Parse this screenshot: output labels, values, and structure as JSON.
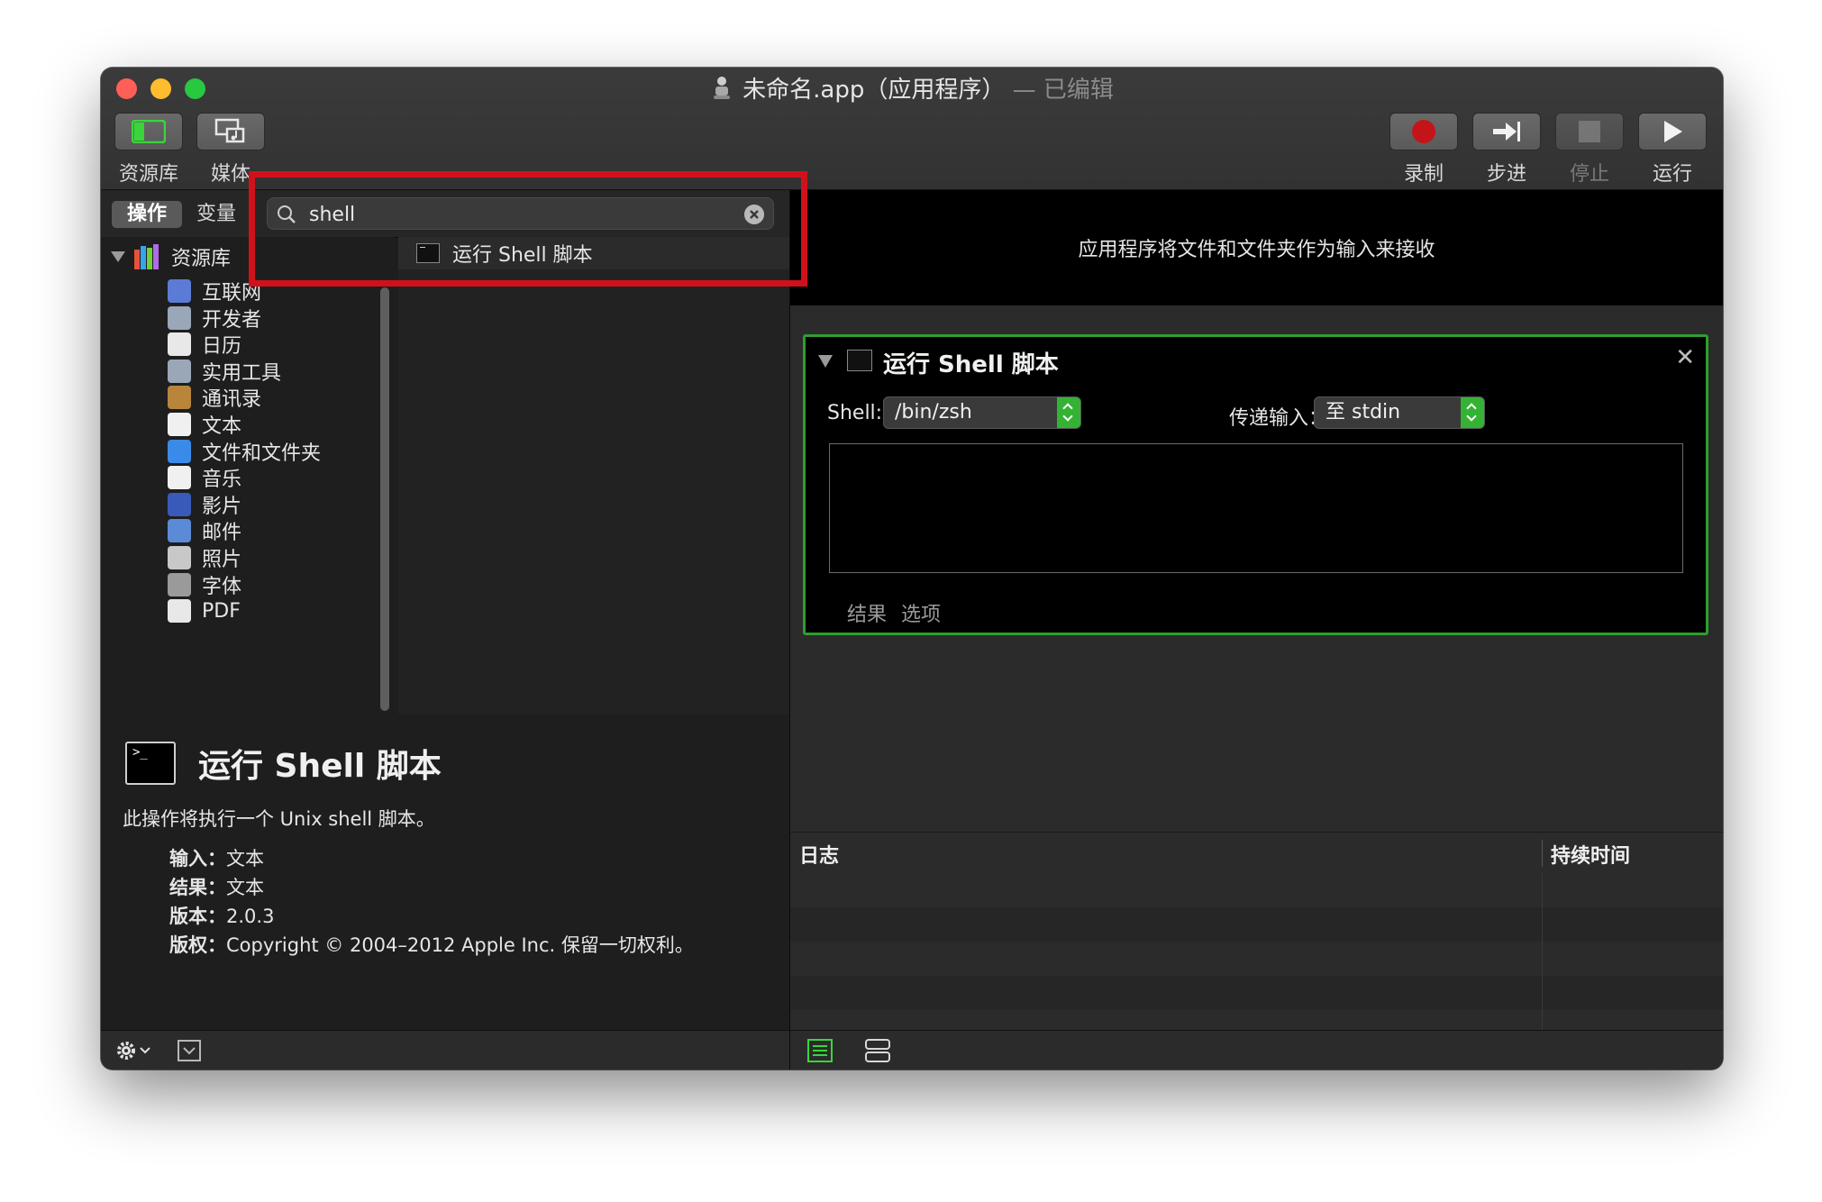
{
  "window": {
    "title": "未命名.app（应用程序）",
    "title_status": "— 已编辑"
  },
  "toolbar": {
    "library_label": "资源库",
    "media_label": "媒体",
    "record_label": "录制",
    "step_label": "步进",
    "stop_label": "停止",
    "run_label": "运行"
  },
  "left_tabs": {
    "actions": "操作",
    "variables": "变量"
  },
  "search": {
    "value": "shell"
  },
  "library": {
    "root": "资源库",
    "items": [
      {
        "label": "互联网",
        "icon": "globe-icon"
      },
      {
        "label": "开发者",
        "icon": "tools-icon"
      },
      {
        "label": "日历",
        "icon": "calendar-icon"
      },
      {
        "label": "实用工具",
        "icon": "tools-icon"
      },
      {
        "label": "通讯录",
        "icon": "contacts-icon"
      },
      {
        "label": "文本",
        "icon": "text-icon"
      },
      {
        "label": "文件和文件夹",
        "icon": "finder-icon"
      },
      {
        "label": "音乐",
        "icon": "music-icon"
      },
      {
        "label": "影片",
        "icon": "movie-icon"
      },
      {
        "label": "邮件",
        "icon": "mail-icon"
      },
      {
        "label": "照片",
        "icon": "photos-icon"
      },
      {
        "label": "字体",
        "icon": "font-icon"
      },
      {
        "label": "PDF",
        "icon": "pdf-icon"
      }
    ]
  },
  "results": [
    {
      "label": "运行 Shell 脚本"
    }
  ],
  "detail": {
    "icon_text": ">_",
    "title": "运行 Shell 脚本",
    "description": "此操作将执行一个 Unix shell 脚本。",
    "input_key": "输入：",
    "input_value": "文本",
    "result_key": "结果：",
    "result_value": "文本",
    "version_key": "版本：",
    "version_value": "2.0.3",
    "copyright_key": "版权：",
    "copyright_value": "Copyright © 2004–2012 Apple Inc. 保留一切权利。"
  },
  "workflow": {
    "banner": "应用程序将文件和文件夹作为输入来接收",
    "action": {
      "title": "运行 Shell 脚本",
      "shell_label": "Shell:",
      "shell_value": "/bin/zsh",
      "pass_label": "传递输入：",
      "pass_value": "至 stdin",
      "script": "",
      "tab_results": "结果",
      "tab_options": "选项"
    }
  },
  "log": {
    "col_log": "日志",
    "col_duration": "持续时间"
  },
  "colors": {
    "highlight": "#d0111c",
    "action_border": "#2e9e2e",
    "record": "#c4141a"
  }
}
